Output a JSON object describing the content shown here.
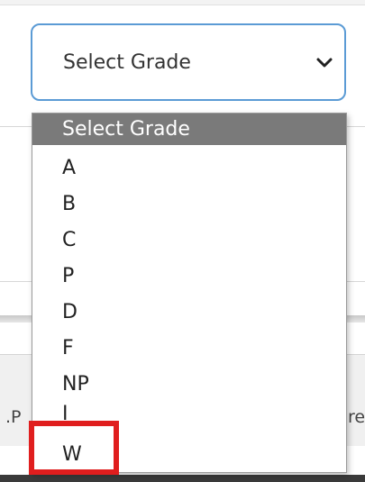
{
  "select": {
    "value": "Select Grade",
    "icon": "chevron-down-icon"
  },
  "dropdown": {
    "options": [
      {
        "label": "Select Grade",
        "selected": true
      },
      {
        "label": "A",
        "selected": false
      },
      {
        "label": "B",
        "selected": false
      },
      {
        "label": "C",
        "selected": false
      },
      {
        "label": "P",
        "selected": false
      },
      {
        "label": "D",
        "selected": false
      },
      {
        "label": "F",
        "selected": false
      },
      {
        "label": "NP",
        "selected": false
      },
      {
        "label": "I",
        "selected": false
      },
      {
        "label": "W",
        "selected": false
      }
    ]
  },
  "background": {
    "left_fragment": ".P",
    "right_fragment": "re"
  },
  "colors": {
    "select_border": "#5b9bd5",
    "selected_option_bg": "#7a7a7a",
    "highlight": "#e01e1e"
  }
}
